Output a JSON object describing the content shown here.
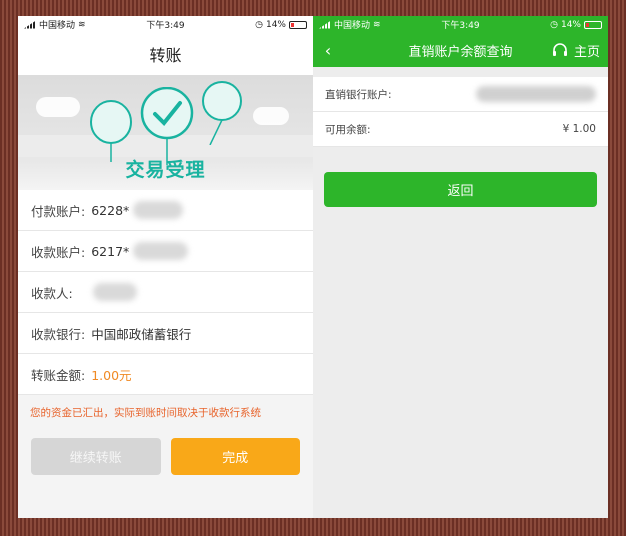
{
  "left": {
    "status": {
      "carrier": "中国移动",
      "time": "下午3:49",
      "battery": "14%"
    },
    "title": "转账",
    "banner_text": "交易受理",
    "rows": [
      {
        "label": "付款账户:",
        "value": "6228*"
      },
      {
        "label": "收款账户:",
        "value": "6217*"
      },
      {
        "label": "收款人:",
        "value": ""
      },
      {
        "label": "收款银行:",
        "value": "中国邮政储蓄银行"
      },
      {
        "label": "转账金额:",
        "value": "1.00元"
      }
    ],
    "notice": "您的资金已汇出，实际到账时间取决于收款行系统",
    "continue_label": "继续转账",
    "done_label": "完成"
  },
  "right": {
    "status": {
      "carrier": "中国移动",
      "time": "下午3:49",
      "battery": "14%"
    },
    "back_symbol": "‹",
    "title": "直销账户余额查询",
    "home_label": "主页",
    "rows": [
      {
        "label": "直销银行账户:",
        "value": ""
      },
      {
        "label": "可用余额:",
        "value": "¥ 1.00"
      }
    ],
    "return_label": "返回"
  },
  "colors": {
    "green": "#2db52a",
    "orange": "#f9a818",
    "teal": "#19b3a0",
    "notice": "#e8642c"
  }
}
